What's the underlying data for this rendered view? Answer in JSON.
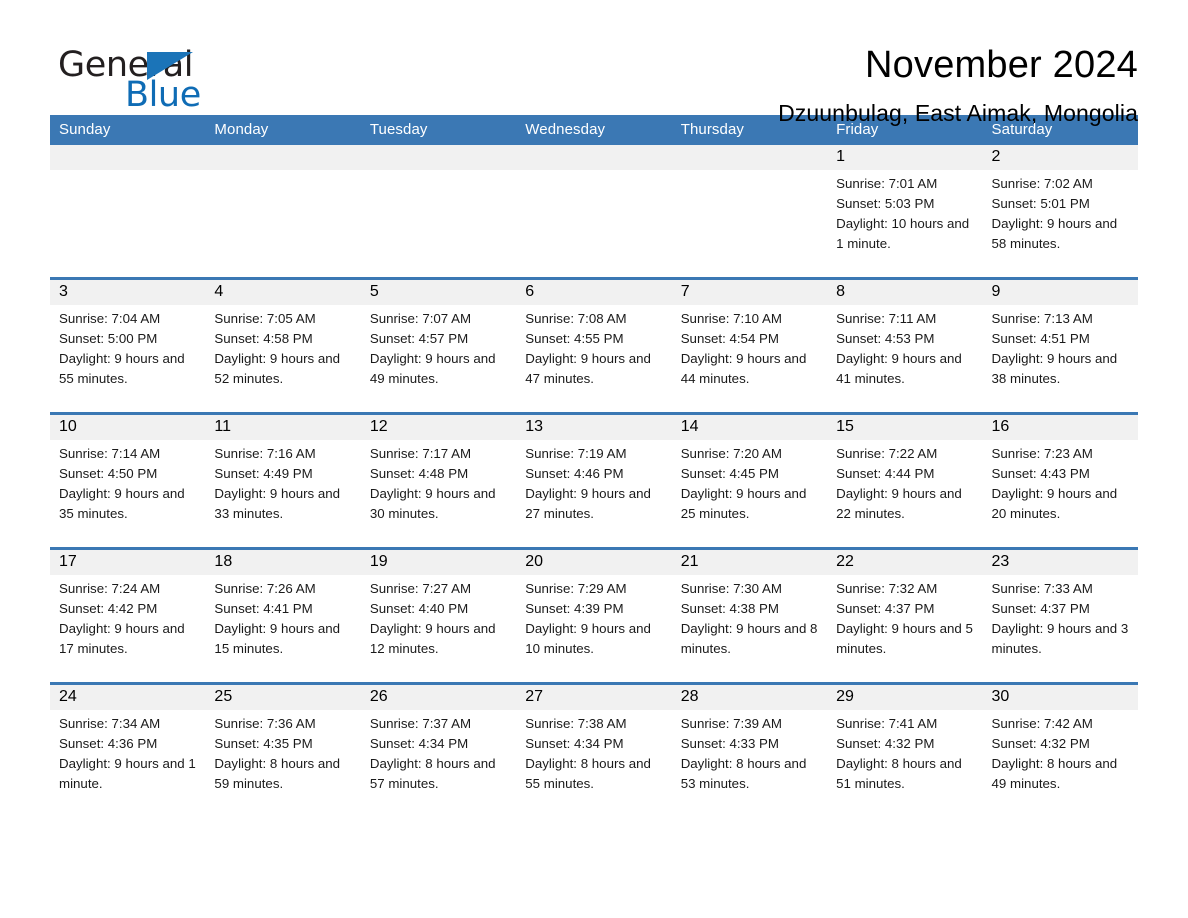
{
  "logo": {
    "word1": "General",
    "word2": "Blue",
    "triangle_color": "#1b74b8",
    "word2_color": "#0f6cb5"
  },
  "header": {
    "title": "November 2024",
    "subtitle": "Dzuunbulag, East Aimak, Mongolia"
  },
  "theme": {
    "header_blue": "#3b78b4",
    "daynum_band": "#f1f1f1",
    "page_background": "#ffffff"
  },
  "weekday_headers": [
    "Sunday",
    "Monday",
    "Tuesday",
    "Wednesday",
    "Thursday",
    "Friday",
    "Saturday"
  ],
  "weeks": [
    [
      {
        "day": "",
        "sunrise": "",
        "sunset": "",
        "daylight": ""
      },
      {
        "day": "",
        "sunrise": "",
        "sunset": "",
        "daylight": ""
      },
      {
        "day": "",
        "sunrise": "",
        "sunset": "",
        "daylight": ""
      },
      {
        "day": "",
        "sunrise": "",
        "sunset": "",
        "daylight": ""
      },
      {
        "day": "",
        "sunrise": "",
        "sunset": "",
        "daylight": ""
      },
      {
        "day": "1",
        "sunrise": "Sunrise: 7:01 AM",
        "sunset": "Sunset: 5:03 PM",
        "daylight": "Daylight: 10 hours and 1 minute."
      },
      {
        "day": "2",
        "sunrise": "Sunrise: 7:02 AM",
        "sunset": "Sunset: 5:01 PM",
        "daylight": "Daylight: 9 hours and 58 minutes."
      }
    ],
    [
      {
        "day": "3",
        "sunrise": "Sunrise: 7:04 AM",
        "sunset": "Sunset: 5:00 PM",
        "daylight": "Daylight: 9 hours and 55 minutes."
      },
      {
        "day": "4",
        "sunrise": "Sunrise: 7:05 AM",
        "sunset": "Sunset: 4:58 PM",
        "daylight": "Daylight: 9 hours and 52 minutes."
      },
      {
        "day": "5",
        "sunrise": "Sunrise: 7:07 AM",
        "sunset": "Sunset: 4:57 PM",
        "daylight": "Daylight: 9 hours and 49 minutes."
      },
      {
        "day": "6",
        "sunrise": "Sunrise: 7:08 AM",
        "sunset": "Sunset: 4:55 PM",
        "daylight": "Daylight: 9 hours and 47 minutes."
      },
      {
        "day": "7",
        "sunrise": "Sunrise: 7:10 AM",
        "sunset": "Sunset: 4:54 PM",
        "daylight": "Daylight: 9 hours and 44 minutes."
      },
      {
        "day": "8",
        "sunrise": "Sunrise: 7:11 AM",
        "sunset": "Sunset: 4:53 PM",
        "daylight": "Daylight: 9 hours and 41 minutes."
      },
      {
        "day": "9",
        "sunrise": "Sunrise: 7:13 AM",
        "sunset": "Sunset: 4:51 PM",
        "daylight": "Daylight: 9 hours and 38 minutes."
      }
    ],
    [
      {
        "day": "10",
        "sunrise": "Sunrise: 7:14 AM",
        "sunset": "Sunset: 4:50 PM",
        "daylight": "Daylight: 9 hours and 35 minutes."
      },
      {
        "day": "11",
        "sunrise": "Sunrise: 7:16 AM",
        "sunset": "Sunset: 4:49 PM",
        "daylight": "Daylight: 9 hours and 33 minutes."
      },
      {
        "day": "12",
        "sunrise": "Sunrise: 7:17 AM",
        "sunset": "Sunset: 4:48 PM",
        "daylight": "Daylight: 9 hours and 30 minutes."
      },
      {
        "day": "13",
        "sunrise": "Sunrise: 7:19 AM",
        "sunset": "Sunset: 4:46 PM",
        "daylight": "Daylight: 9 hours and 27 minutes."
      },
      {
        "day": "14",
        "sunrise": "Sunrise: 7:20 AM",
        "sunset": "Sunset: 4:45 PM",
        "daylight": "Daylight: 9 hours and 25 minutes."
      },
      {
        "day": "15",
        "sunrise": "Sunrise: 7:22 AM",
        "sunset": "Sunset: 4:44 PM",
        "daylight": "Daylight: 9 hours and 22 minutes."
      },
      {
        "day": "16",
        "sunrise": "Sunrise: 7:23 AM",
        "sunset": "Sunset: 4:43 PM",
        "daylight": "Daylight: 9 hours and 20 minutes."
      }
    ],
    [
      {
        "day": "17",
        "sunrise": "Sunrise: 7:24 AM",
        "sunset": "Sunset: 4:42 PM",
        "daylight": "Daylight: 9 hours and 17 minutes."
      },
      {
        "day": "18",
        "sunrise": "Sunrise: 7:26 AM",
        "sunset": "Sunset: 4:41 PM",
        "daylight": "Daylight: 9 hours and 15 minutes."
      },
      {
        "day": "19",
        "sunrise": "Sunrise: 7:27 AM",
        "sunset": "Sunset: 4:40 PM",
        "daylight": "Daylight: 9 hours and 12 minutes."
      },
      {
        "day": "20",
        "sunrise": "Sunrise: 7:29 AM",
        "sunset": "Sunset: 4:39 PM",
        "daylight": "Daylight: 9 hours and 10 minutes."
      },
      {
        "day": "21",
        "sunrise": "Sunrise: 7:30 AM",
        "sunset": "Sunset: 4:38 PM",
        "daylight": "Daylight: 9 hours and 8 minutes."
      },
      {
        "day": "22",
        "sunrise": "Sunrise: 7:32 AM",
        "sunset": "Sunset: 4:37 PM",
        "daylight": "Daylight: 9 hours and 5 minutes."
      },
      {
        "day": "23",
        "sunrise": "Sunrise: 7:33 AM",
        "sunset": "Sunset: 4:37 PM",
        "daylight": "Daylight: 9 hours and 3 minutes."
      }
    ],
    [
      {
        "day": "24",
        "sunrise": "Sunrise: 7:34 AM",
        "sunset": "Sunset: 4:36 PM",
        "daylight": "Daylight: 9 hours and 1 minute."
      },
      {
        "day": "25",
        "sunrise": "Sunrise: 7:36 AM",
        "sunset": "Sunset: 4:35 PM",
        "daylight": "Daylight: 8 hours and 59 minutes."
      },
      {
        "day": "26",
        "sunrise": "Sunrise: 7:37 AM",
        "sunset": "Sunset: 4:34 PM",
        "daylight": "Daylight: 8 hours and 57 minutes."
      },
      {
        "day": "27",
        "sunrise": "Sunrise: 7:38 AM",
        "sunset": "Sunset: 4:34 PM",
        "daylight": "Daylight: 8 hours and 55 minutes."
      },
      {
        "day": "28",
        "sunrise": "Sunrise: 7:39 AM",
        "sunset": "Sunset: 4:33 PM",
        "daylight": "Daylight: 8 hours and 53 minutes."
      },
      {
        "day": "29",
        "sunrise": "Sunrise: 7:41 AM",
        "sunset": "Sunset: 4:32 PM",
        "daylight": "Daylight: 8 hours and 51 minutes."
      },
      {
        "day": "30",
        "sunrise": "Sunrise: 7:42 AM",
        "sunset": "Sunset: 4:32 PM",
        "daylight": "Daylight: 8 hours and 49 minutes."
      }
    ]
  ]
}
